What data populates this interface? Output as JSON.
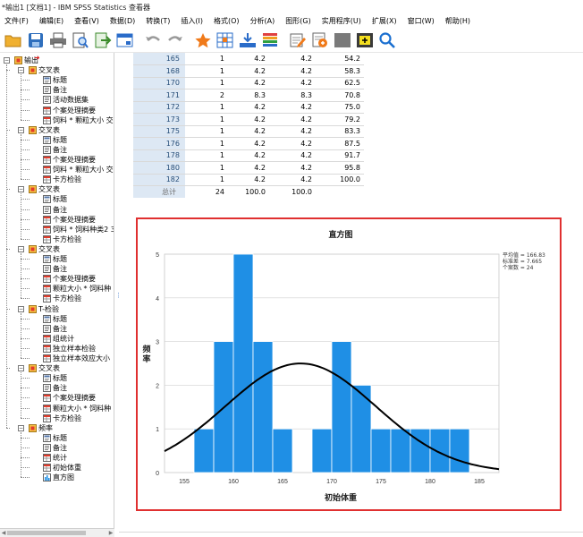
{
  "window": {
    "title": "*输出1 [文档1] - IBM SPSS Statistics 查看器"
  },
  "menu": [
    "文件(F)",
    "编辑(E)",
    "查看(V)",
    "数据(D)",
    "转换(T)",
    "插入(I)",
    "格式(O)",
    "分析(A)",
    "图形(G)",
    "实用程序(U)",
    "扩展(X)",
    "窗口(W)",
    "帮助(H)"
  ],
  "toolbar": [
    "open-icon",
    "save-icon",
    "print-icon",
    "print-preview-icon",
    "export-icon",
    "recall-dialog-icon",
    "undo-icon",
    "redo-icon",
    "go-to-data-icon",
    "go-to-case-icon",
    "go-to-variable-icon",
    "variables-icon",
    "designate-window-icon",
    "insert-text-icon",
    "hide-icon",
    "promote-icon",
    "find-icon"
  ],
  "outline": {
    "nodes": [
      {
        "label": "输出",
        "level": 0,
        "icon": "book",
        "expander": "−"
      },
      {
        "label": "交叉表",
        "level": 1,
        "icon": "book",
        "expander": "−"
      },
      {
        "label": "标题",
        "level": 2,
        "icon": "title"
      },
      {
        "label": "备注",
        "level": 2,
        "icon": "note"
      },
      {
        "label": "活动数据集",
        "level": 2,
        "icon": "note"
      },
      {
        "label": "个案处理摘要",
        "level": 2,
        "icon": "table"
      },
      {
        "label": "饲料 * 颗粒大小 交",
        "level": 2,
        "icon": "table"
      },
      {
        "label": "交叉表",
        "level": 1,
        "icon": "book",
        "expander": "−"
      },
      {
        "label": "标题",
        "level": 2,
        "icon": "title"
      },
      {
        "label": "备注",
        "level": 2,
        "icon": "note"
      },
      {
        "label": "个案处理摘要",
        "level": 2,
        "icon": "table"
      },
      {
        "label": "饲料 * 颗粒大小 交",
        "level": 2,
        "icon": "table"
      },
      {
        "label": "卡方检验",
        "level": 2,
        "icon": "table"
      },
      {
        "label": "交叉表",
        "level": 1,
        "icon": "book",
        "expander": "−"
      },
      {
        "label": "标题",
        "level": 2,
        "icon": "title"
      },
      {
        "label": "备注",
        "level": 2,
        "icon": "note"
      },
      {
        "label": "个案处理摘要",
        "level": 2,
        "icon": "table"
      },
      {
        "label": "饲料 * 饲料种类2 3",
        "level": 2,
        "icon": "table"
      },
      {
        "label": "卡方检验",
        "level": 2,
        "icon": "table"
      },
      {
        "label": "交叉表",
        "level": 1,
        "icon": "book",
        "expander": "−"
      },
      {
        "label": "标题",
        "level": 2,
        "icon": "title"
      },
      {
        "label": "备注",
        "level": 2,
        "icon": "note"
      },
      {
        "label": "个案处理摘要",
        "level": 2,
        "icon": "table"
      },
      {
        "label": "颗粒大小 * 饲料种",
        "level": 2,
        "icon": "table"
      },
      {
        "label": "卡方检验",
        "level": 2,
        "icon": "table"
      },
      {
        "label": "T-检验",
        "level": 1,
        "icon": "book",
        "expander": "−"
      },
      {
        "label": "标题",
        "level": 2,
        "icon": "title"
      },
      {
        "label": "备注",
        "level": 2,
        "icon": "note"
      },
      {
        "label": "组统计",
        "level": 2,
        "icon": "table"
      },
      {
        "label": "独立样本检验",
        "level": 2,
        "icon": "table"
      },
      {
        "label": "独立样本效应大小",
        "level": 2,
        "icon": "table"
      },
      {
        "label": "交叉表",
        "level": 1,
        "icon": "book",
        "expander": "−"
      },
      {
        "label": "标题",
        "level": 2,
        "icon": "title"
      },
      {
        "label": "备注",
        "level": 2,
        "icon": "note"
      },
      {
        "label": "个案处理摘要",
        "level": 2,
        "icon": "table"
      },
      {
        "label": "颗粒大小 * 饲料种",
        "level": 2,
        "icon": "table"
      },
      {
        "label": "卡方检验",
        "level": 2,
        "icon": "table"
      },
      {
        "label": "频率",
        "level": 1,
        "icon": "book",
        "expander": "−"
      },
      {
        "label": "标题",
        "level": 2,
        "icon": "title",
        "marker": true
      },
      {
        "label": "备注",
        "level": 2,
        "icon": "note"
      },
      {
        "label": "统计",
        "level": 2,
        "icon": "table"
      },
      {
        "label": "初始体重",
        "level": 2,
        "icon": "table"
      },
      {
        "label": "直方图",
        "level": 2,
        "icon": "chart"
      }
    ]
  },
  "freq_table": {
    "rows": [
      [
        "165",
        "1",
        "4.2",
        "4.2",
        "54.2"
      ],
      [
        "168",
        "1",
        "4.2",
        "4.2",
        "58.3"
      ],
      [
        "170",
        "1",
        "4.2",
        "4.2",
        "62.5"
      ],
      [
        "171",
        "2",
        "8.3",
        "8.3",
        "70.8"
      ],
      [
        "172",
        "1",
        "4.2",
        "4.2",
        "75.0"
      ],
      [
        "173",
        "1",
        "4.2",
        "4.2",
        "79.2"
      ],
      [
        "175",
        "1",
        "4.2",
        "4.2",
        "83.3"
      ],
      [
        "176",
        "1",
        "4.2",
        "4.2",
        "87.5"
      ],
      [
        "178",
        "1",
        "4.2",
        "4.2",
        "91.7"
      ],
      [
        "180",
        "1",
        "4.2",
        "4.2",
        "95.8"
      ],
      [
        "182",
        "1",
        "4.2",
        "4.2",
        "100.0"
      ]
    ],
    "total": [
      "总计",
      "24",
      "100.0",
      "100.0",
      ""
    ]
  },
  "chart_data": {
    "type": "bar",
    "title": "直方图",
    "xlabel": "初始体重",
    "ylabel": "频率",
    "xlim": [
      153,
      187
    ],
    "ylim": [
      0,
      5
    ],
    "xticks": [
      155,
      160,
      165,
      170,
      175,
      180,
      185
    ],
    "yticks": [
      0,
      1,
      2,
      3,
      4,
      5
    ],
    "bins": [
      {
        "x0": 156,
        "x1": 158,
        "value": 1
      },
      {
        "x0": 158,
        "x1": 160,
        "value": 3
      },
      {
        "x0": 160,
        "x1": 162,
        "value": 5
      },
      {
        "x0": 162,
        "x1": 164,
        "value": 3
      },
      {
        "x0": 164,
        "x1": 166,
        "value": 1
      },
      {
        "x0": 166,
        "x1": 168,
        "value": 0
      },
      {
        "x0": 168,
        "x1": 170,
        "value": 1
      },
      {
        "x0": 170,
        "x1": 172,
        "value": 3
      },
      {
        "x0": 172,
        "x1": 174,
        "value": 2
      },
      {
        "x0": 174,
        "x1": 176,
        "value": 1
      },
      {
        "x0": 176,
        "x1": 178,
        "value": 1
      },
      {
        "x0": 178,
        "x1": 180,
        "value": 1
      },
      {
        "x0": 180,
        "x1": 182,
        "value": 1
      },
      {
        "x0": 182,
        "x1": 184,
        "value": 1
      }
    ],
    "normal_curve": {
      "mean": 166.83,
      "sd": 7.665,
      "n": 24,
      "bin_width": 2
    },
    "stats": [
      "平均值 = 166.83",
      "标准差 = 7.665",
      "个案数 = 24"
    ],
    "bar_color": "#1f8fe5",
    "curve_color": "#000000",
    "grid": true
  },
  "colors": {
    "frame": "#e03030",
    "row_header_bg": "#dde8f4",
    "row_header_text": "#274e78"
  }
}
